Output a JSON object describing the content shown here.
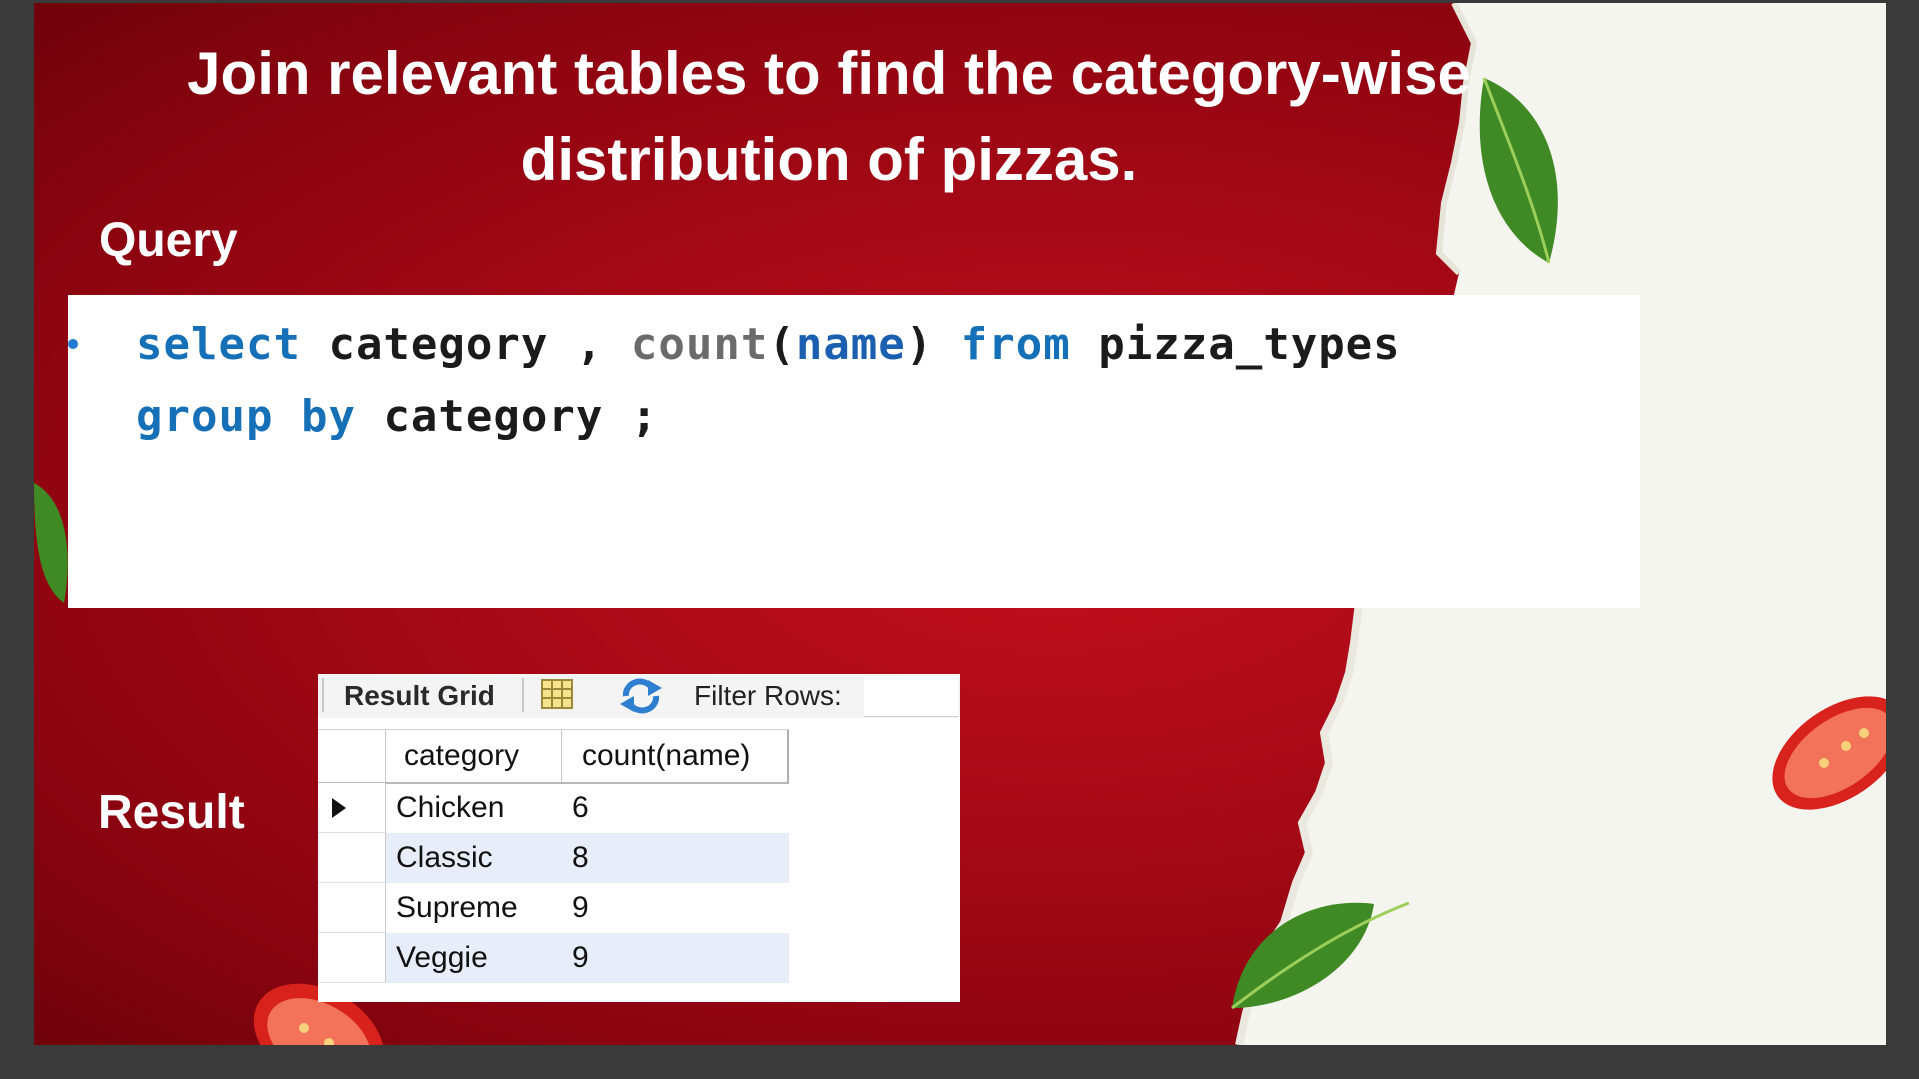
{
  "slide": {
    "title": "Join relevant tables to find the category-wise distribution of pizzas.",
    "query_label": "Query",
    "result_label": "Result"
  },
  "code": {
    "line1": {
      "kw_select": "select",
      "col_category": "category",
      "comma": ",",
      "fn_count": "count",
      "paren_open": "(",
      "arg_name": "name",
      "paren_close": ")",
      "kw_from": "from",
      "table": "pizza_types"
    },
    "line2": {
      "kw_group": "group",
      "kw_by": "by",
      "col_category": "category",
      "semicolon": ";"
    }
  },
  "result_grid": {
    "tab_label": "Result Grid",
    "filter_label": "Filter Rows:",
    "filter_value": "",
    "form_icon": "form-editor-icon",
    "refresh_icon": "refresh-icon",
    "columns": [
      "category",
      "count(name)"
    ],
    "rows": [
      {
        "category": "Chicken",
        "count": "6"
      },
      {
        "category": "Classic",
        "count": "8"
      },
      {
        "category": "Supreme",
        "count": "9"
      },
      {
        "category": "Veggie",
        "count": "9"
      }
    ]
  },
  "colors": {
    "background_red": "#a70916",
    "keyword_blue": "#1670b8",
    "row_highlight": "#e8eef9"
  }
}
